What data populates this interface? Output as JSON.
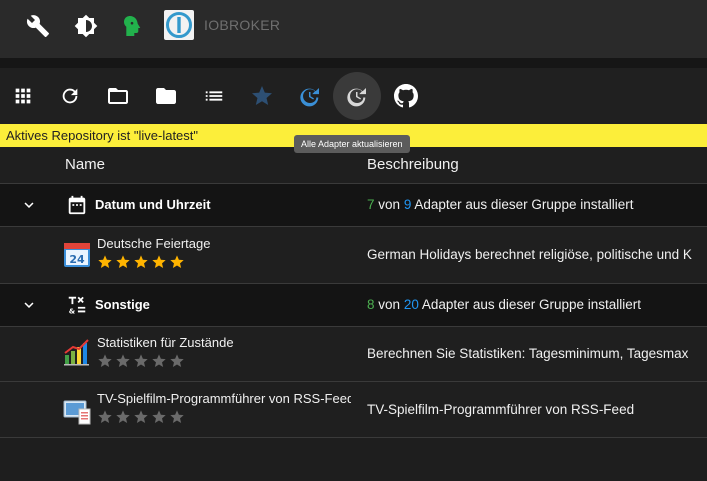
{
  "app": {
    "brand": "IOBROKER"
  },
  "toolbar": {
    "tooltip": "Alle Adapter aktualisieren"
  },
  "banner": {
    "text": "Aktives Repository ist \"live-latest\""
  },
  "table": {
    "col_name": "Name",
    "col_desc": "Beschreibung"
  },
  "groups": [
    {
      "title": "Datum und Uhrzeit",
      "installed": "7",
      "total": "9",
      "word_von": "von",
      "suffix": "Adapter aus dieser Gruppe installiert",
      "adapters": [
        {
          "name": "Deutsche Feiertage",
          "rating": 5,
          "description": "German Holidays berechnet religiöse, politische und K"
        }
      ]
    },
    {
      "title": "Sonstige",
      "installed": "8",
      "total": "20",
      "word_von": "von",
      "suffix": "Adapter aus dieser Gruppe installiert",
      "adapters": [
        {
          "name": "Statistiken für Zustände",
          "rating": 0,
          "description": "Berechnen Sie Statistiken: Tagesminimum, Tagesmax"
        },
        {
          "name": "TV-Spielfilm-Programmführer von RSS-Feed",
          "rating": 0,
          "description": "TV-Spielfilm-Programmführer von RSS-Feed"
        }
      ]
    }
  ],
  "colors": {
    "installed": "#4caf50",
    "total": "#2196f3",
    "star_on": "#ffb400",
    "star_off": "#6a6a6a",
    "banner": "#fcee3a"
  }
}
